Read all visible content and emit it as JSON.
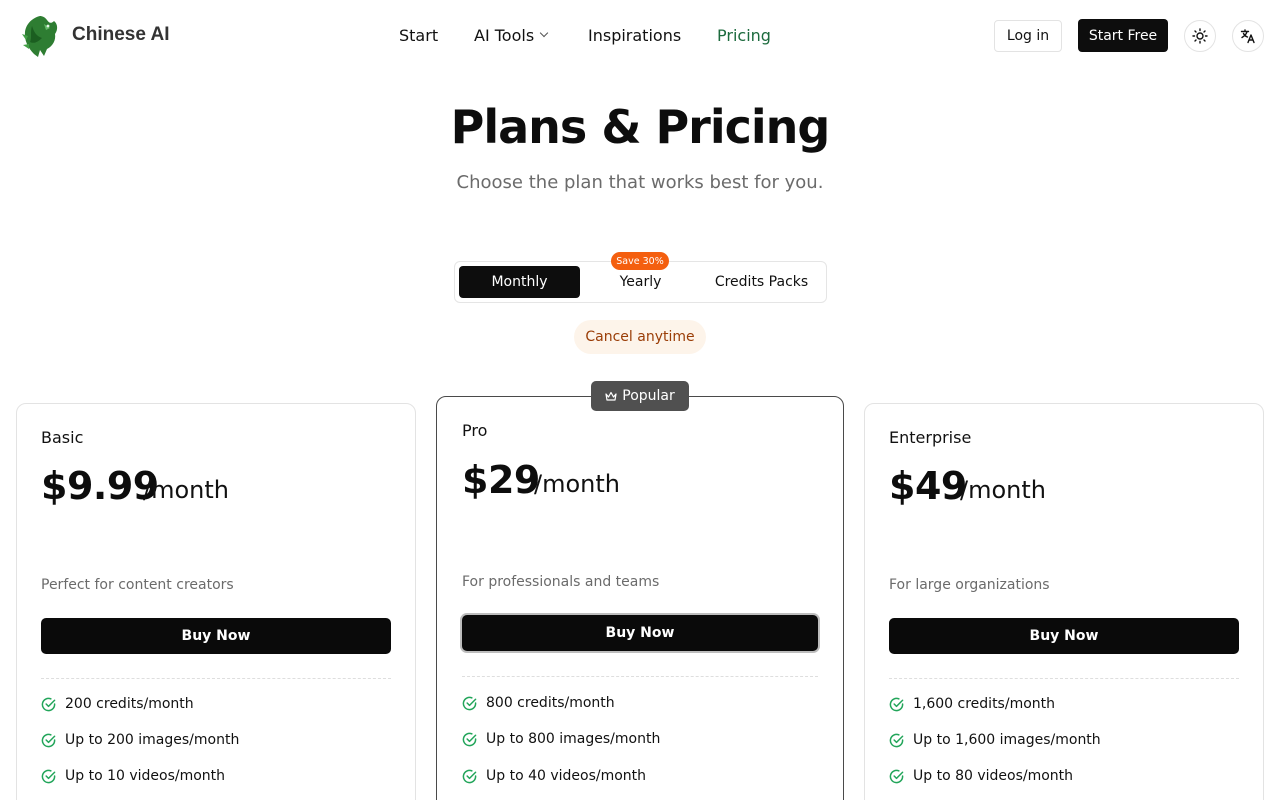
{
  "header": {
    "brand": "Chinese AI",
    "nav": [
      {
        "label": "Start"
      },
      {
        "label": "AI Tools"
      },
      {
        "label": "Inspirations"
      },
      {
        "label": "Pricing"
      }
    ],
    "login_label": "Log in",
    "start_label": "Start Free",
    "theme_icon": "sun-icon",
    "language_icon": "translate-icon",
    "active_nav_color": "#1d6b3e"
  },
  "hero": {
    "title": "Plans & Pricing",
    "subtitle": "Choose the plan that works best for you."
  },
  "billing": {
    "tabs": [
      {
        "label": "Monthly",
        "active": true
      },
      {
        "label": "Yearly",
        "active": false
      },
      {
        "label": "Credits Packs",
        "active": false
      }
    ],
    "save_badge": "Save 30%",
    "cancel_note": "Cancel anytime"
  },
  "plans": [
    {
      "name": "Basic",
      "price": "$9.99",
      "period": "/month",
      "description": "Perfect for content creators",
      "cta": "Buy Now",
      "features": [
        "200 credits/month",
        "Up to 200 images/month",
        "Up to 10 videos/month"
      ]
    },
    {
      "name": "Pro",
      "badge": "Popular",
      "price": "$29",
      "period": "/month",
      "description": "For professionals and teams",
      "cta": "Buy Now",
      "features": [
        "800 credits/month",
        "Up to 800 images/month",
        "Up to 40 videos/month"
      ]
    },
    {
      "name": "Enterprise",
      "price": "$49",
      "period": "/month",
      "description": "For large organizations",
      "cta": "Buy Now",
      "features": [
        "1,600 credits/month",
        "Up to 1,600 images/month",
        "Up to 80 videos/month"
      ]
    }
  ],
  "colors": {
    "primary": "#0d0d0d",
    "badge_orange": "#f45f0f",
    "check_green": "#22a55a"
  }
}
